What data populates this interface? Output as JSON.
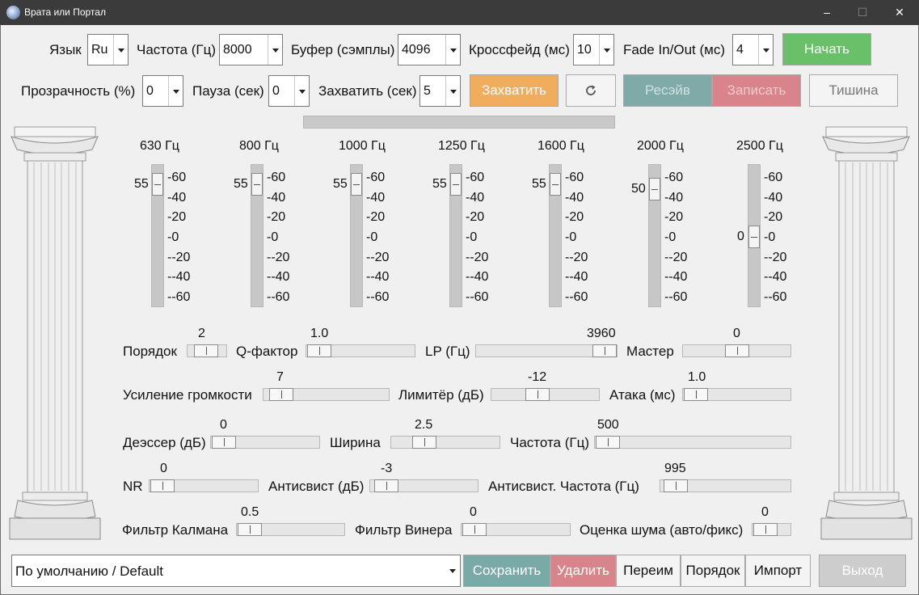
{
  "window": {
    "title": "Врата или Портал",
    "controls": {
      "minimize": "–",
      "maximize": "☐",
      "close": "✕"
    }
  },
  "row1": {
    "language": {
      "label": "Язык",
      "value": "Ru"
    },
    "frequency": {
      "label": "Частота (Гц)",
      "value": "8000"
    },
    "buffer": {
      "label": "Буфер (сэмплы)",
      "value": "4096"
    },
    "crossfade": {
      "label": "Кроссфейд (мс)",
      "value": "10"
    },
    "fade": {
      "label": "Fade In/Out (мс)",
      "value": "4"
    },
    "start_label": "Начать"
  },
  "row2": {
    "opacity": {
      "label": "Прозрачность (%)",
      "value": "0"
    },
    "pause": {
      "label": "Пауза (сек)",
      "value": "0"
    },
    "capture": {
      "label": "Захватить (сек)",
      "value": "5"
    },
    "capture_button": "Захватить",
    "refresh_icon": "refresh-icon",
    "resave_label": "Ресэйв",
    "record_label": "Записать",
    "silence_label": "Тишина"
  },
  "equalizer": {
    "scale": [
      "-60",
      "-40",
      "-20",
      "-0",
      "--20",
      "--40",
      "--60"
    ],
    "bands": [
      {
        "freq": "630 Гц",
        "value": "55",
        "level": 55
      },
      {
        "freq": "800 Гц",
        "value": "55",
        "level": 55
      },
      {
        "freq": "1000 Гц",
        "value": "55",
        "level": 55
      },
      {
        "freq": "1250 Гц",
        "value": "55",
        "level": 55
      },
      {
        "freq": "1600 Гц",
        "value": "55",
        "level": 55
      },
      {
        "freq": "2000 Гц",
        "value": "50",
        "level": 50
      },
      {
        "freq": "2500 Гц",
        "value": "0",
        "level": 0
      }
    ]
  },
  "sliders": {
    "order": {
      "label": "Порядок",
      "value": "2"
    },
    "q_factor": {
      "label": "Q-фактор",
      "value": "1.0"
    },
    "lp": {
      "label": "LP (Гц)",
      "value": "3960"
    },
    "master": {
      "label": "Мастер",
      "value": "0"
    },
    "gain": {
      "label": "Усиление громкости",
      "value": "7"
    },
    "limiter": {
      "label": "Лимитёр (дБ)",
      "value": "-12"
    },
    "attack": {
      "label": "Атака (мс)",
      "value": "1.0"
    },
    "deesser": {
      "label": "Деэссер (дБ)",
      "value": "0"
    },
    "width": {
      "label": "Ширина",
      "value": "2.5"
    },
    "deess_freq": {
      "label": "Частота (Гц)",
      "value": "500"
    },
    "nr": {
      "label": "NR",
      "value": "0"
    },
    "antiwhistle": {
      "label": "Антисвист (дБ)",
      "value": "-3"
    },
    "antiwhistle_freq": {
      "label": "Антисвист. Частота (Гц)",
      "value": "995"
    },
    "kalman": {
      "label": "Фильтр Калмана",
      "value": "0.5"
    },
    "wiener": {
      "label": "Фильтр Винера",
      "value": "0"
    },
    "noise_est": {
      "label": "Оценка шума (авто/фикс)",
      "value": "0"
    }
  },
  "bottom": {
    "preset": "По умолчанию / Default",
    "save": "Сохранить",
    "delete": "Удалить",
    "rename": "Переим",
    "order": "Порядок",
    "import": "Импорт",
    "exit": "Выход"
  },
  "colors": {
    "start": "#6abf69",
    "capture": "#f0ad5e",
    "resave": "#7faaa8",
    "record": "#d9838a",
    "save": "#79aaa7",
    "delete": "#d9838a"
  }
}
